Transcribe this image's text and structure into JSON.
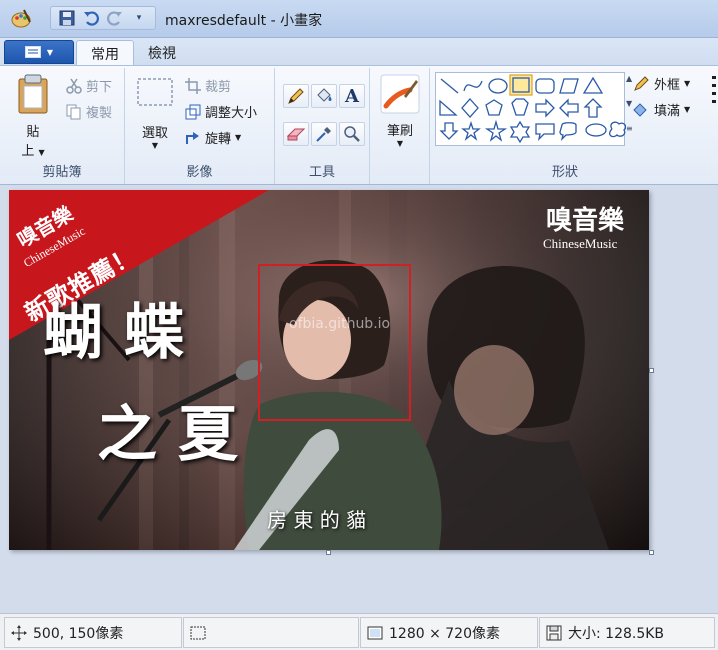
{
  "titlebar": {
    "title": "maxresdefault - 小畫家",
    "app_icon": "paint-palette-icon",
    "quick_access": [
      "save-icon",
      "undo-icon",
      "redo-icon",
      "customize-dropdown-icon"
    ]
  },
  "tabs": {
    "file_icon": "file-menu-icon",
    "home": "常用",
    "view": "檢視"
  },
  "ribbon": {
    "clipboard": {
      "paste": "貼",
      "paste_sub": "上",
      "cut": "剪下",
      "copy": "複製",
      "label": "剪貼簿"
    },
    "image": {
      "select": "選取",
      "crop": "裁剪",
      "resize": "調整大小",
      "rotate": "旋轉",
      "label": "影像"
    },
    "tools": {
      "label": "工具",
      "items": [
        "pencil-icon",
        "fill-bucket-icon",
        "text-icon",
        "eraser-icon",
        "color-picker-icon",
        "magnifier-icon"
      ]
    },
    "brushes": {
      "label": "筆刷"
    },
    "shapes": {
      "outline": "外框",
      "fill": "填滿",
      "label": "形狀"
    }
  },
  "canvas": {
    "banner_top": "嗅音樂",
    "banner_sub": "ChineseMusic",
    "banner_main": "新歌推薦！",
    "logo_main": "嗅音樂",
    "logo_sub": "ChineseMusic",
    "song_title_1": "蝴 蝶",
    "song_title_2": "之 夏",
    "artist": "房 東 的 貓",
    "watermark": "ofbia.github.io",
    "colors": {
      "banner": "#c8161d",
      "selection": "#d11f26"
    }
  },
  "statusbar": {
    "cursor": "500, 150像素",
    "dimensions": "1280 × 720像素",
    "size": "大小: 128.5KB"
  }
}
